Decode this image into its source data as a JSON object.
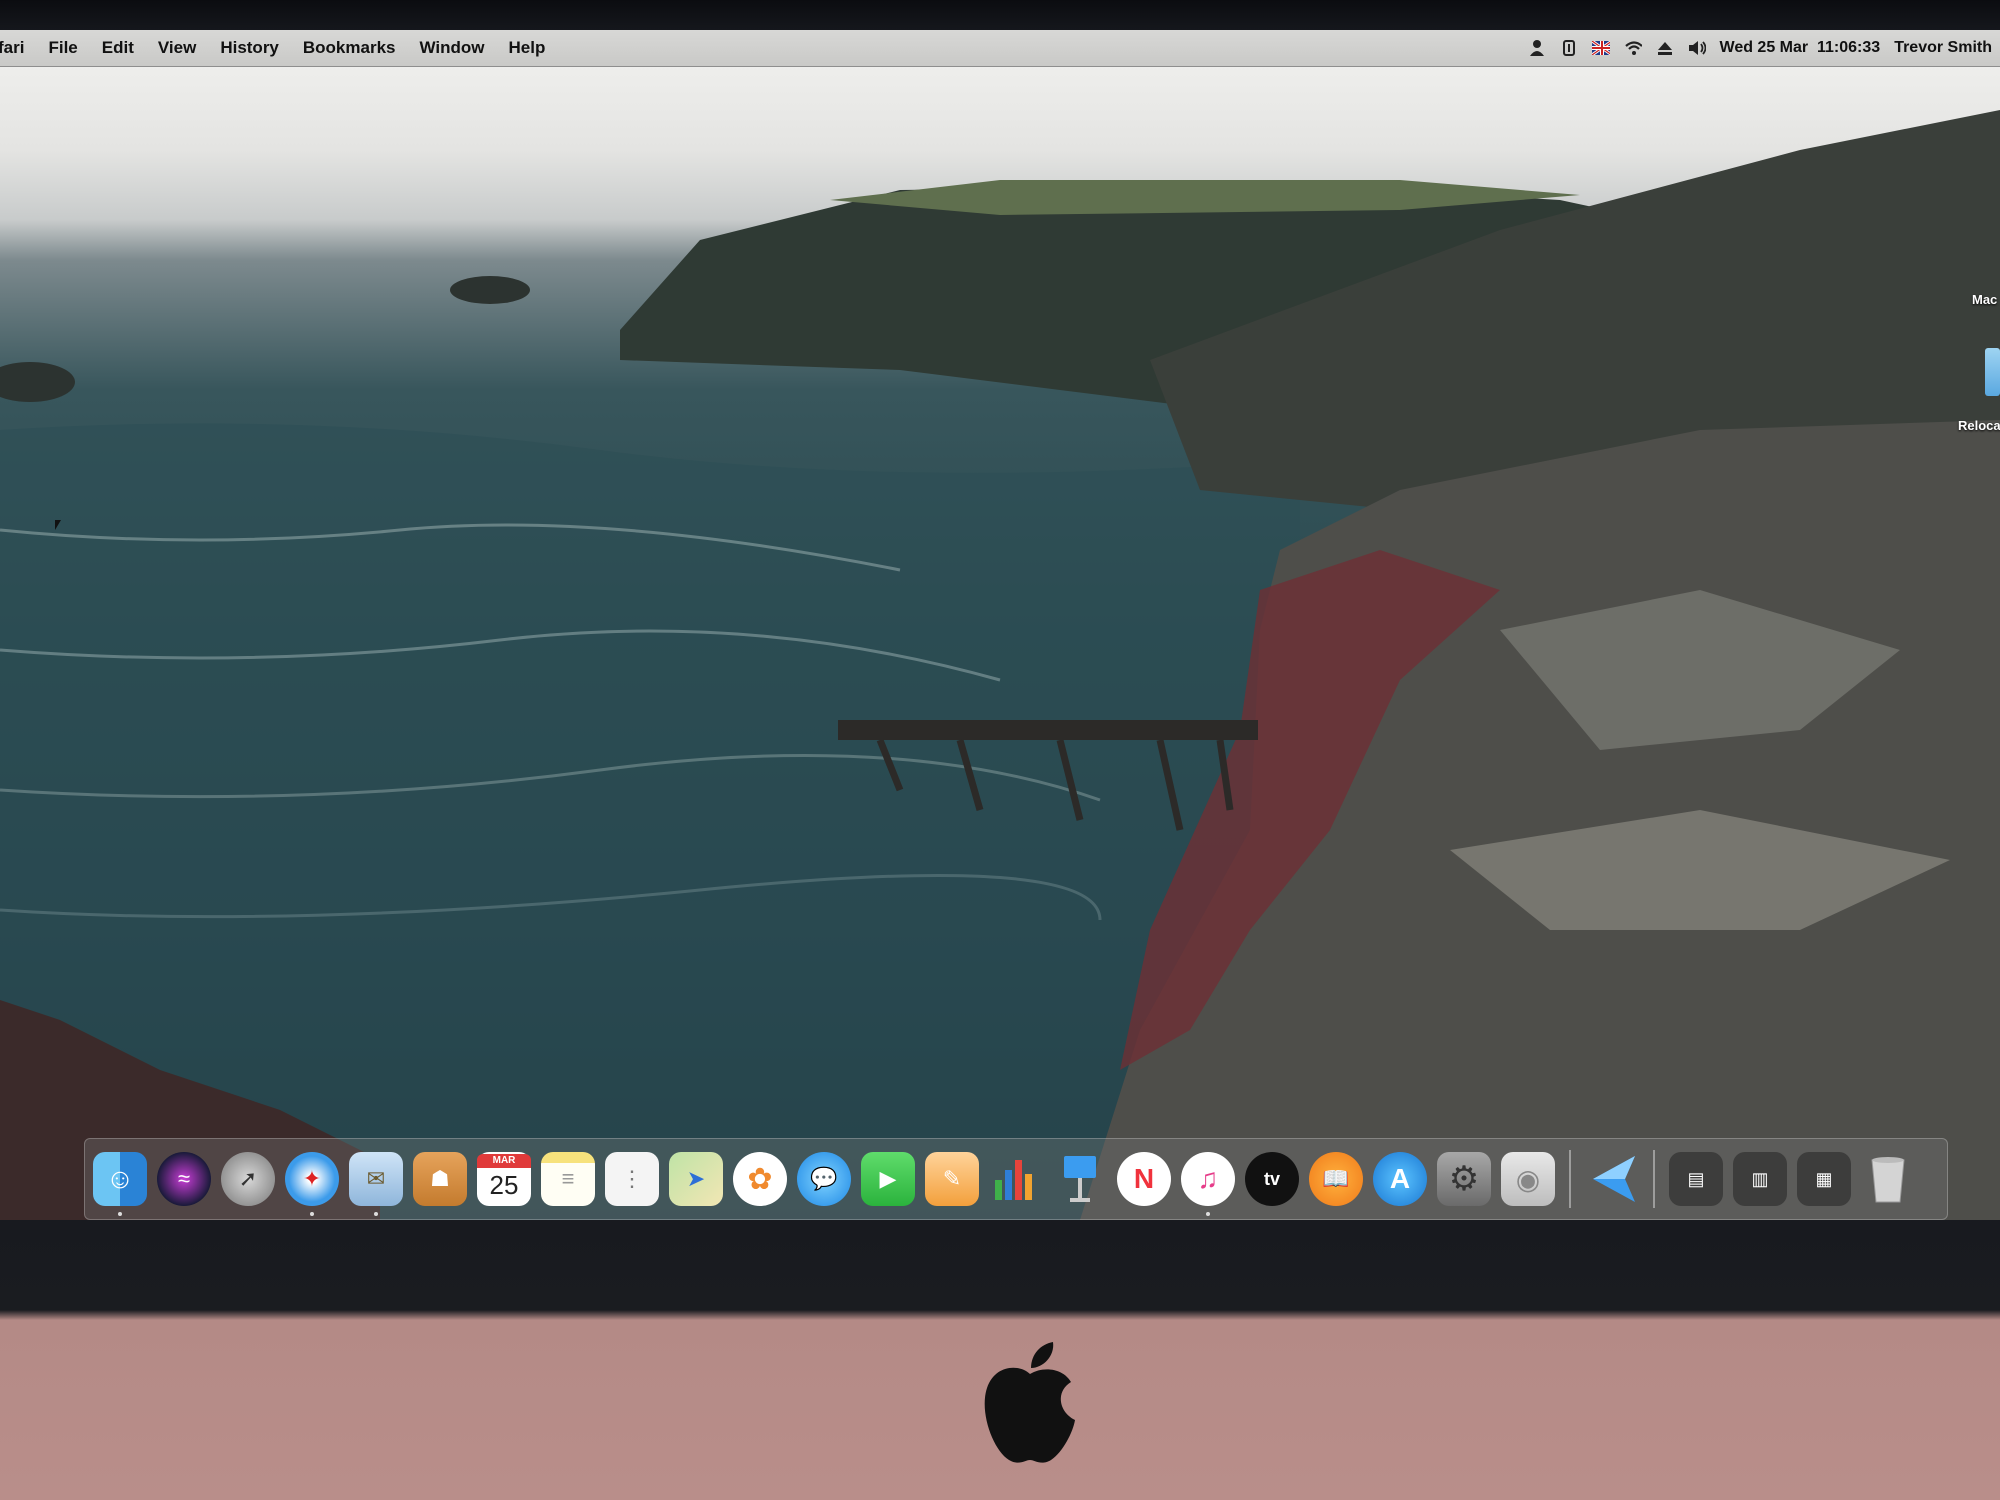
{
  "menubar": {
    "app_name": "fari",
    "items": [
      "File",
      "Edit",
      "View",
      "History",
      "Bookmarks",
      "Window",
      "Help"
    ],
    "clock": "Wed 25 Mar  11:06:33",
    "user": "Trevor Smith",
    "status_icons": [
      "user-icon",
      "input-icon",
      "uk-flag-icon",
      "wifi-icon",
      "eject-icon",
      "volume-icon"
    ]
  },
  "desktop": {
    "labels": [
      "Mac",
      "Reloca"
    ]
  },
  "dock": {
    "apps": [
      {
        "name": "finder",
        "running": true
      },
      {
        "name": "siri",
        "running": false
      },
      {
        "name": "launchpad",
        "running": false
      },
      {
        "name": "safari",
        "running": true
      },
      {
        "name": "mail",
        "running": true
      },
      {
        "name": "contacts",
        "running": false
      },
      {
        "name": "calendar",
        "month": "MAR",
        "day": "25",
        "running": false
      },
      {
        "name": "notes",
        "running": false
      },
      {
        "name": "reminders",
        "running": false
      },
      {
        "name": "maps",
        "running": false
      },
      {
        "name": "photos",
        "running": false
      },
      {
        "name": "messages",
        "running": false
      },
      {
        "name": "facetime",
        "running": false
      },
      {
        "name": "pages",
        "running": false
      },
      {
        "name": "numbers",
        "running": false
      },
      {
        "name": "keynote",
        "running": false
      },
      {
        "name": "news",
        "running": false
      },
      {
        "name": "music",
        "running": true
      },
      {
        "name": "tv",
        "label": "tv",
        "running": false
      },
      {
        "name": "books",
        "running": false
      },
      {
        "name": "app-store",
        "running": false
      },
      {
        "name": "system-preferences",
        "running": false
      },
      {
        "name": "dvd-player",
        "running": false
      },
      {
        "name": "migration",
        "running": false
      }
    ],
    "stacks": [
      "downloads-stack",
      "documents-stack",
      "applications-stack",
      "trash"
    ]
  }
}
